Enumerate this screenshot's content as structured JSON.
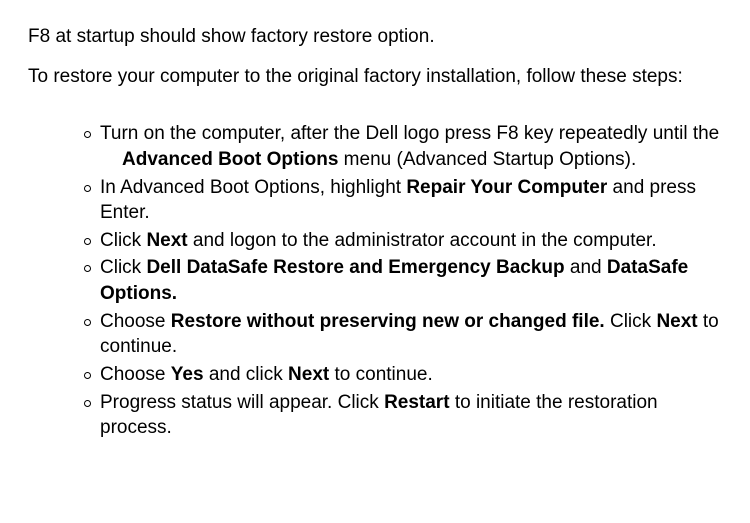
{
  "intro": {
    "p1": "F8 at startup should show factory restore option.",
    "p2": "To restore your computer to the original factory installation, follow these steps:"
  },
  "steps": {
    "s1a": "Turn on the computer, after the Dell logo press F8 key repeatedly until the",
    "s1b_bold": "Advanced Boot Options",
    "s1b_rest": " menu (Advanced Startup Options).",
    "s2a": "In Advanced Boot Options, highlight ",
    "s2b_bold": "Repair Your Computer",
    "s2c": " and press Enter.",
    "s3a": "Click ",
    "s3b_bold": "Next",
    "s3c": " and logon to the administrator account in the computer.",
    "s4a": "Click ",
    "s4b_bold": "Dell DataSafe Restore and Emergency Backup",
    "s4c": " and ",
    "s4d_bold": "DataSafe Options.",
    "s5a": "Choose ",
    "s5b_bold": "Restore without preserving new or changed file.",
    "s5c": " Click ",
    "s5d_bold": "Next",
    "s5e": " to continue.",
    "s6a": "Choose ",
    "s6b_bold": "Yes",
    "s6c": " and click ",
    "s6d_bold": "Next",
    "s6e": " to continue.",
    "s7a": "Progress status will appear. Click ",
    "s7b_bold": "Restart",
    "s7c": " to initiate the restoration process."
  }
}
